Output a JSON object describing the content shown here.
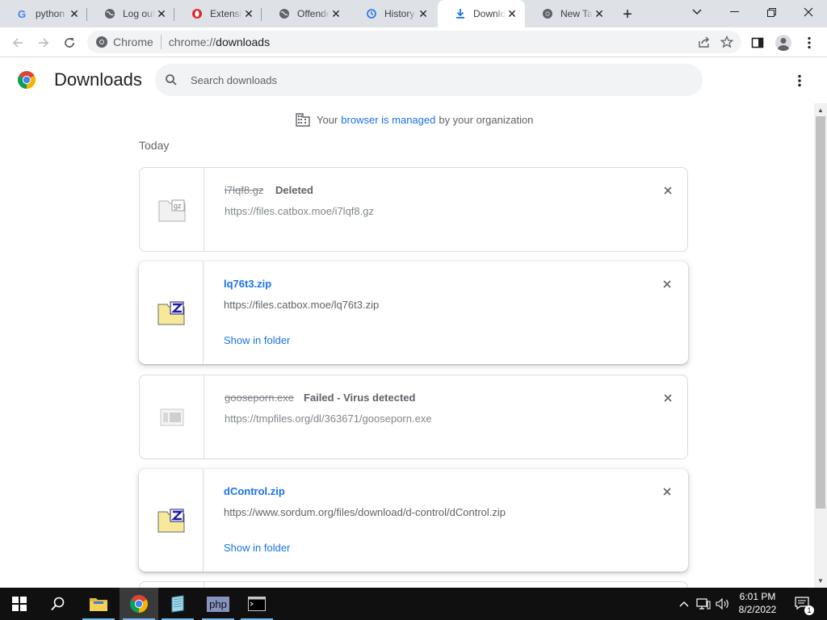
{
  "tabs": [
    {
      "label": "python",
      "icon": "google-icon"
    },
    {
      "label": "Log out",
      "icon": "globe-icon"
    },
    {
      "label": "Extensio",
      "icon": "opera-icon"
    },
    {
      "label": "Offende",
      "icon": "globe-icon"
    },
    {
      "label": "History",
      "icon": "history-icon"
    },
    {
      "label": "Downlo",
      "icon": "download-icon",
      "active": true
    },
    {
      "label": "New Tal",
      "icon": "chrome-icon"
    }
  ],
  "toolbar": {
    "site_chip": "Chrome",
    "url_scheme": "chrome://",
    "url_host": "downloads"
  },
  "page": {
    "title": "Downloads",
    "search_placeholder": "Search downloads",
    "managed_prefix": "Your",
    "managed_link": "browser is managed",
    "managed_suffix": "by your organization",
    "section_today": "Today"
  },
  "downloads": [
    {
      "name": "i7lqf8.gz",
      "status": "Deleted",
      "url": "https://files.catbox.moe/i7lqf8.gz",
      "file_type": "gz",
      "state": "deleted"
    },
    {
      "name": "lq76t3.zip",
      "url": "https://files.catbox.moe/lq76t3.zip",
      "action": "Show in folder",
      "file_type": "zip",
      "state": "complete"
    },
    {
      "name": "gooseporn.exe",
      "status": "Failed - Virus detected",
      "url": "https://tmpfiles.org/dl/363671/gooseporn.exe",
      "file_type": "exe",
      "state": "failed"
    },
    {
      "name": "dControl.zip",
      "url": "https://www.sordum.org/files/download/d-control/dControl.zip",
      "action": "Show in folder",
      "file_type": "zip",
      "state": "complete"
    }
  ],
  "taskbar": {
    "time": "6:01 PM",
    "date": "8/2/2022",
    "notification_count": "1",
    "php_label": "php"
  },
  "colors": {
    "accent": "#1a73e8",
    "tabstrip": "#dee1e6",
    "taskbar": "#101010"
  }
}
